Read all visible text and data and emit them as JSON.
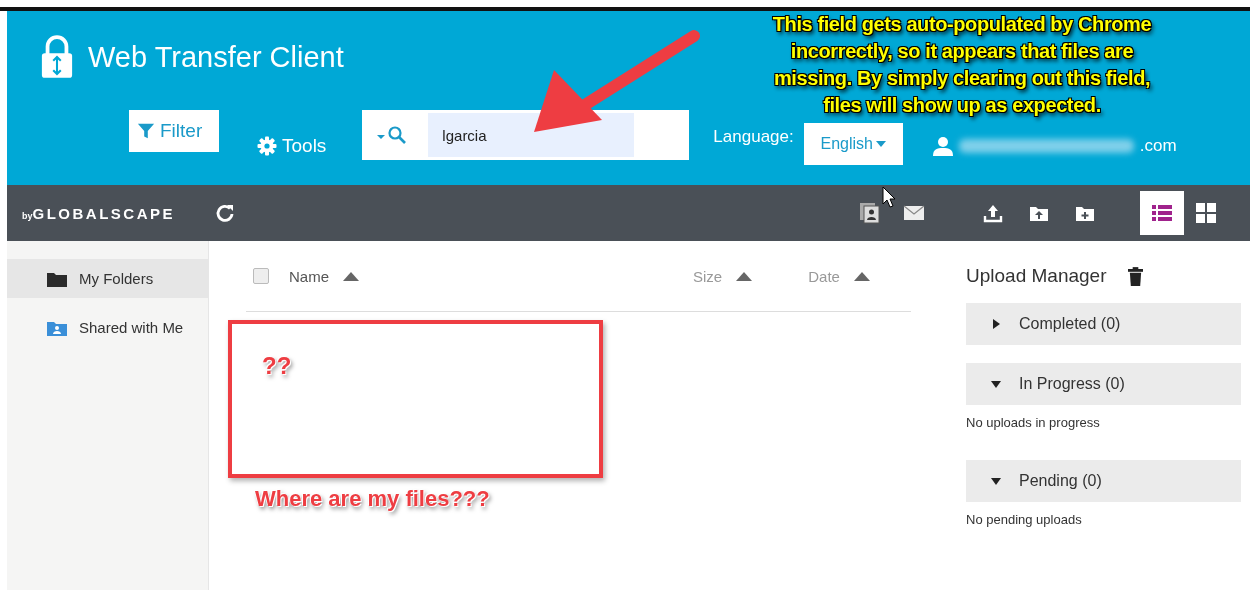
{
  "header": {
    "title": "Web Transfer Client",
    "filter_button": "Filter",
    "tools_button": "Tools",
    "search": {
      "value": "lgarcia"
    },
    "language_label": "Language:",
    "language": "English",
    "user_email": ".com"
  },
  "toolbar": {
    "brand_prefix": "by",
    "brand_name": "GLOBALSCAPE",
    "views": [
      {
        "kind": "list",
        "selected": true
      },
      {
        "kind": "grid",
        "selected": false
      }
    ]
  },
  "sidebar": {
    "items": [
      {
        "label": "My Folders",
        "kind": "folder",
        "selected": true
      },
      {
        "label": "Shared with Me",
        "kind": "shared",
        "selected": false
      }
    ]
  },
  "file_list": {
    "select_all_checked": false,
    "columns": [
      "Name",
      "Size",
      "Date"
    ]
  },
  "upload_manager": {
    "title": "Upload Manager",
    "sections": [
      {
        "label": "Completed (0)",
        "expanded": false
      },
      {
        "label": "In Progress (0)",
        "expanded": true,
        "message": "No uploads in progress"
      },
      {
        "label": "Pending (0)",
        "expanded": true,
        "message": "No pending uploads"
      }
    ]
  },
  "annotations": {
    "callout": [
      "This field gets auto-populated by Chrome",
      "incorrectly, so it appears that files are",
      "missing. By simply clearing out this field,",
      "files will show up as expected."
    ],
    "box_label": "??",
    "caption": "Where are my files???"
  }
}
